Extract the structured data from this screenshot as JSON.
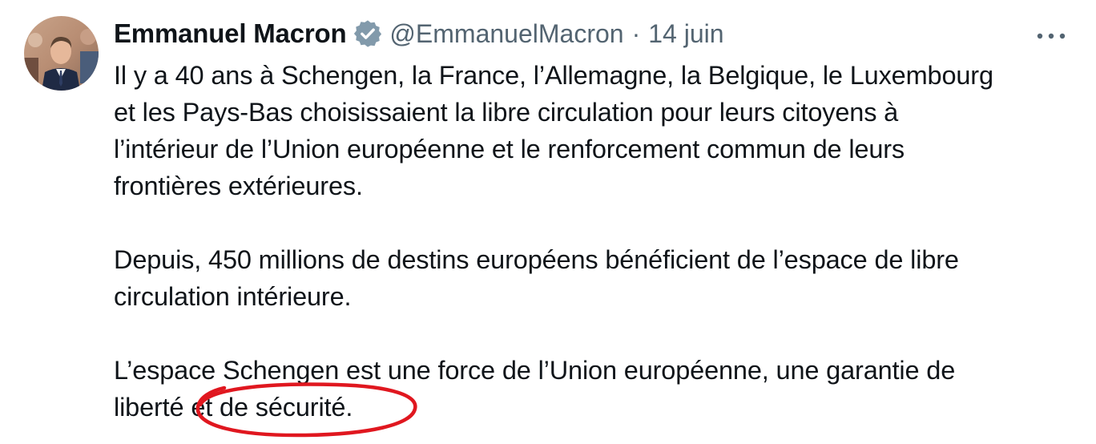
{
  "tweet": {
    "author_name": "Emmanuel Macron",
    "verified_badge_icon": "verified-badge-icon",
    "handle": "@EmmanuelMacron",
    "separator": "·",
    "date": "14 juin",
    "more_icon": "more-options-icon",
    "paragraphs": [
      "Il y a 40 ans à Schengen, la France, l’Allemagne, la Belgique, le Luxembourg\net les Pays-Bas choisissaient la libre circulation pour leurs citoyens à\nl’intérieur de l’Union européenne et le renforcement commun de leurs\nfrontières extérieures.",
      "Depuis, 450 millions de destins européens bénéficient de l’espace de libre\ncirculation intérieure.",
      "L’espace Schengen est une force de l’Union européenne, une garantie de\nliberté et de sécurité."
    ]
  },
  "colors": {
    "text": "#0f1419",
    "secondary_text": "#536471",
    "badge": "#829aab",
    "annotation": "#e0171f"
  }
}
